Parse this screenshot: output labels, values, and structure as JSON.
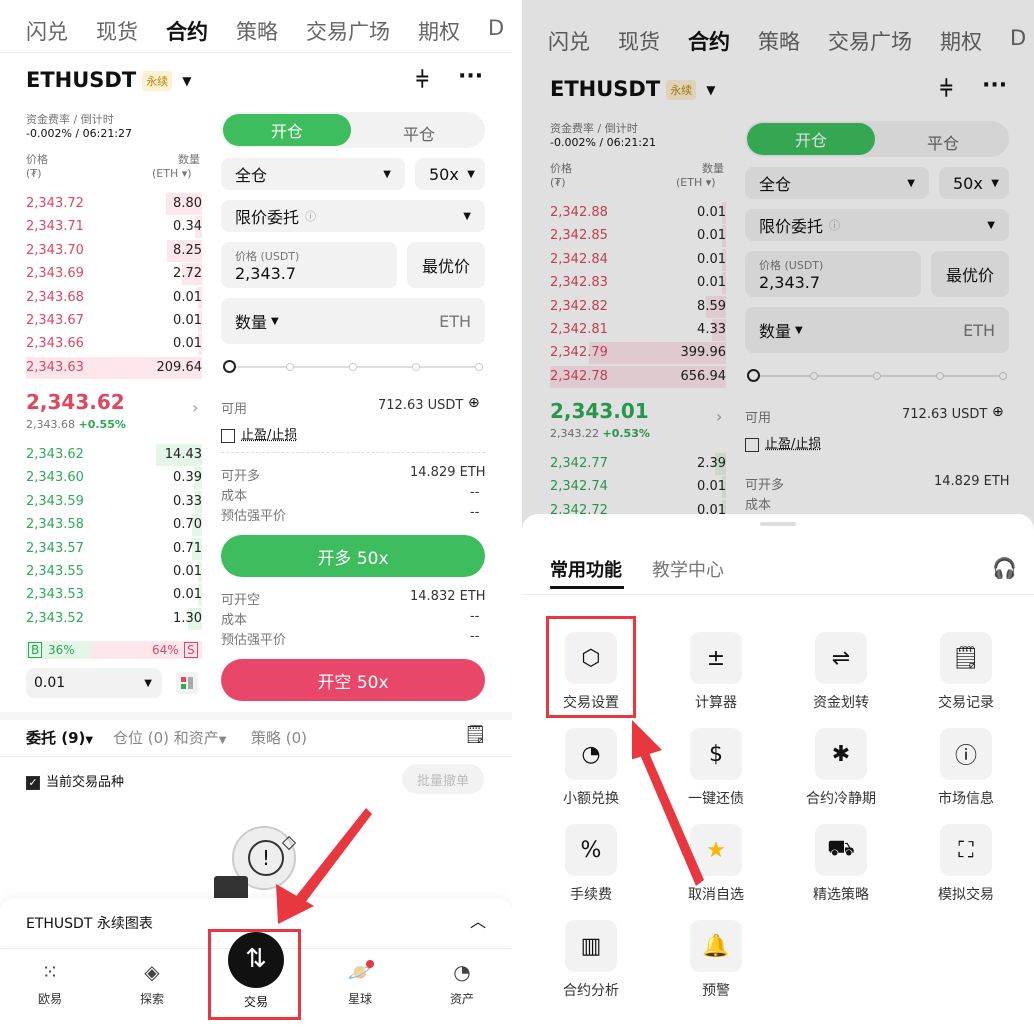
{
  "left": {
    "tabs": [
      "闪兑",
      "现货",
      "合约",
      "策略",
      "交易广场",
      "期权",
      "D"
    ],
    "active_tab": "合约",
    "symbol": "ETHUSDT",
    "perp": "永续",
    "funding_label": "资金费率 / 倒计时",
    "funding_value": "-0.002% / 06:21:27",
    "price_hdr": "价格",
    "price_unit": "(₮)",
    "qty_hdr": "数量",
    "qty_unit": "(ETH ▾)",
    "asks": [
      [
        "2,343.72",
        "8.80"
      ],
      [
        "2,343.71",
        "0.34"
      ],
      [
        "2,343.70",
        "8.25"
      ],
      [
        "2,343.69",
        "2.72"
      ],
      [
        "2,343.68",
        "0.01"
      ],
      [
        "2,343.67",
        "0.01"
      ],
      [
        "2,343.66",
        "0.01"
      ],
      [
        "2,343.63",
        "209.64"
      ]
    ],
    "last_price": "2,343.62",
    "mark": "2,343.68",
    "change": "+0.55%",
    "bids": [
      [
        "2,343.62",
        "14.43"
      ],
      [
        "2,343.60",
        "0.39"
      ],
      [
        "2,343.59",
        "0.33"
      ],
      [
        "2,343.58",
        "0.70"
      ],
      [
        "2,343.57",
        "0.71"
      ],
      [
        "2,343.55",
        "0.01"
      ],
      [
        "2,343.53",
        "0.01"
      ],
      [
        "2,343.52",
        "1.30"
      ]
    ],
    "b_label": "B",
    "b_pct": "36%",
    "s_pct": "64%",
    "s_label": "S",
    "depth": "0.01",
    "open_tab": "开仓",
    "close_tab": "平仓",
    "margin_mode": "全仓",
    "leverage": "50x",
    "order_type": "限价委托",
    "price_label": "价格 (USDT)",
    "price_value": "2,343.7",
    "best_price": "最优价",
    "qty_label": "数量",
    "qty_unit2": "ETH",
    "avail_label": "可用",
    "avail_value": "712.63 USDT",
    "tpsl": "止盈/止损",
    "long_max_label": "可开多",
    "long_max": "14.829 ETH",
    "cost_label": "成本",
    "cost_val": "--",
    "liq_label": "预估强平价",
    "liq_val": "--",
    "buy_btn": "开多 50x",
    "short_max_label": "可开空",
    "short_max": "14.832 ETH",
    "sell_btn": "开空 50x",
    "orders_tab": "委托 (9)",
    "positions_tab": "仓位 (0) 和资产",
    "strategy_tab": "策略 (0)",
    "current_pair": "当前交易品种",
    "batch_cancel": "批量撤单",
    "chart_bar": "ETHUSDT 永续图表",
    "nav": [
      "欧易",
      "探索",
      "交易",
      "星球",
      "资产"
    ]
  },
  "right": {
    "tabs": [
      "闪兑",
      "现货",
      "合约",
      "策略",
      "交易广场",
      "期权",
      "D"
    ],
    "symbol": "ETHUSDT",
    "perp": "永续",
    "funding_label": "资金费率 / 倒计时",
    "funding_value": "-0.002% / 06:21:21",
    "asks": [
      [
        "2,342.88",
        "0.01"
      ],
      [
        "2,342.85",
        "0.01"
      ],
      [
        "2,342.84",
        "0.01"
      ],
      [
        "2,342.83",
        "0.01"
      ],
      [
        "2,342.82",
        "8.59"
      ],
      [
        "2,342.81",
        "4.33"
      ],
      [
        "2,342.79",
        "399.96"
      ],
      [
        "2,342.78",
        "656.94"
      ]
    ],
    "last_price": "2,343.01",
    "mark": "2,343.22",
    "change": "+0.53%",
    "bids": [
      [
        "2,342.77",
        "2.39"
      ],
      [
        "2,342.74",
        "0.01"
      ],
      [
        "2,342.72",
        "0.01"
      ]
    ],
    "sheet_tab1": "常用功能",
    "sheet_tab2": "教学中心",
    "items": [
      "交易设置",
      "计算器",
      "资金划转",
      "交易记录",
      "小额兑换",
      "一键还债",
      "合约冷静期",
      "市场信息",
      "手续费",
      "取消自选",
      "精选策略",
      "模拟交易",
      "合约分析",
      "预警"
    ]
  },
  "colors": {
    "green": "#3dbd5e",
    "red": "#e8476a",
    "highlight": "#e8373f"
  }
}
